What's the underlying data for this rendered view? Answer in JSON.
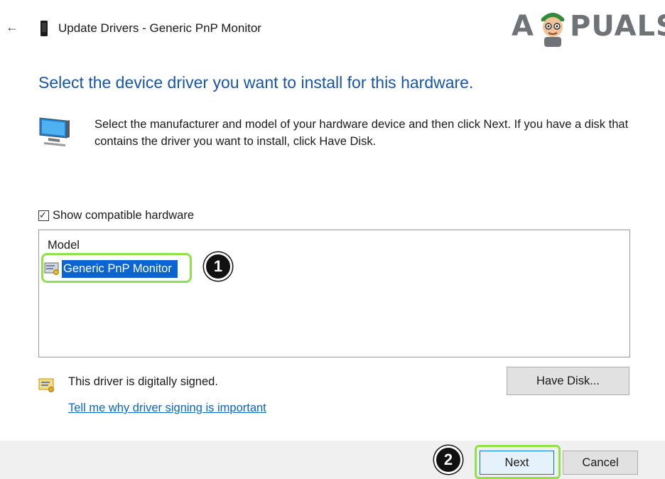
{
  "window": {
    "title": "Update Drivers - Generic PnP Monitor",
    "back_glyph": "←"
  },
  "watermark": {
    "brand_prefix": "A",
    "brand_suffix": "PUALS"
  },
  "wizard": {
    "heading": "Select the device driver you want to install for this hardware.",
    "instructions": "Select the manufacturer and model of your hardware device and then click Next. If you have a disk that contains the driver you want to install, click Have Disk.",
    "show_compatible": {
      "label": "Show compatible hardware",
      "checked": true,
      "check_glyph": "✓"
    },
    "model_list": {
      "header": "Model",
      "items": [
        {
          "label": "Generic PnP Monitor",
          "selected": true
        }
      ]
    },
    "signed_text": "This driver is digitally signed.",
    "signing_link": "Tell me why driver signing is important",
    "have_disk_label": "Have Disk..."
  },
  "footer": {
    "next_label": "Next",
    "cancel_label": "Cancel"
  },
  "step_badges": [
    "1",
    "2"
  ],
  "colors": {
    "heading": "#1a55a4",
    "selection": "#0a64d2",
    "link": "#0a66c2",
    "highlight": "#8ee34a",
    "footer_bg": "#f0f0f0"
  }
}
